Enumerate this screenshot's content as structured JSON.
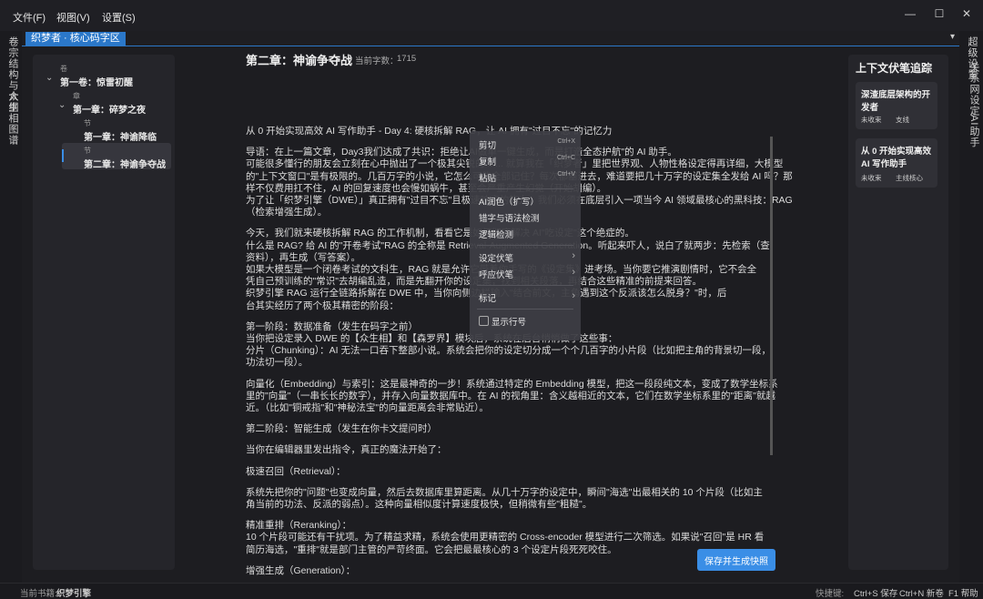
{
  "menubar": {
    "items": [
      "文件(F)",
      "视图(V)",
      "设置(S)"
    ],
    "window_controls": [
      "—",
      "☐",
      "✕"
    ]
  },
  "left_rail": {
    "tabs": [
      "卷宗结构与大纲",
      "众生相图谱"
    ]
  },
  "right_rail": {
    "tabs": [
      "超级设置",
      "关系网设定",
      "AI助手"
    ]
  },
  "tab": {
    "label": "织梦者 · 核心码字区"
  },
  "tree": {
    "volume_tag": "卷",
    "volume": "第一卷：惊雷初醒",
    "chapter_tag": "章",
    "chapter": "第一章：碎梦之夜",
    "sections": [
      {
        "tag": "节",
        "title": "第一章：神谕降临"
      },
      {
        "tag": "节",
        "title": "第二章：神谕争夺战"
      }
    ]
  },
  "editor": {
    "title": "第二章：神谕争夺战",
    "word_count_label": "当前字数：",
    "word_count": "1715",
    "lines": [
      "从 0 开始实现高效 AI 写作助手 - Day 4: 硬核拆解 RAG，让 AI 拥有\"过目不忘\"的记忆力",
      "",
      "      导语：在上一篇文章，Day3我们达成了共识：拒绝让AI做单一键生成，而是打造全态护航\"的 AI 助手。",
      "可能很多懂行的朋友会立刻在心中抛出了一个极其尖锐的 ...... 就算我在「织梦者」里把世界观、人物性格设定得再详细，大模型",
      "的\"上下文窗口\"是有极限的。几百万字的小说，它怎么可能全部记住？每次都塞进去，难道要把几十万字的设定集全发给 AI 吗？那",
      "样不仅费用扛不住，AI 的回复速度也会慢如蜗牛，甚至会严重产生幻觉（开始胡编）。",
      "为了让「织梦引擎（DWE）」真正拥有\"过目不忘\"且极速响应的能力，我们必须在底层引入一项当今 AI 领域最核心的黑科技：RAG",
      "（检索增强生成）。",
      "",
      "      今天，我们就来硬核拆解 RAG 的工作机制，看看它是如何彻底解决 AI\"吃设定\"这个绝症的。",
      "什么是 RAG? 给 AI 的\"开卷考试\"RAG 的全称是 Retrieval-Augmented Generation。听起来吓人，说白了就两步：先检索（查",
      "资料），再生成（写答案）。",
      "      如果大模型是一个闭卷考试的文科生，RAG 就是允许它带着你手写的《设定集》进考场。当你要它推演剧情时，它不会全",
      "凭自己预训练的\"常识\"去胡编乱造，而是先翻开你的设定集，找到相关段落，再结合这些精准的前提来回答。",
      "织梦引擎 RAG 运行全链路拆解在 DWE 中，当你向侧边栏输入\"结合前文，主角遇到这个反派该怎么脱身？\"时，后",
      "台其实经历了两个极其精密的阶段：",
      "",
      "第一阶段：数据准备（发生在码字之前）",
      "      当你把设定录入 DWE 的【众生相】和【森罗界】模块后，系统在后台悄悄做了这些事：",
      "分片（Chunking）：AI 无法一口吞下整部小说。系统会把你的设定切分成一个个几百字的小片段（比如把主角的背景切一段，",
      "功法切一段）。",
      "",
      "      向量化（Embedding）与索引：这是最神奇的一步！系统通过特定的 Embedding 模型，把这一段段纯文本，变成了数学坐标系",
      "里的\"向量\"（一串长长的数字），并存入向量数据库中。在 AI 的视角里：含义越相近的文本，它们在数学坐标系里的\"距离\"就越",
      "近。（比如\"铜戒指\"和\"神秘法宝\"的向量距离会非常贴近）。",
      "",
      "第二阶段：智能生成（发生在你卡文提问时）",
      "",
      "当你在编辑器里发出指令，真正的魔法开始了：",
      "",
      "极速召回（Retrieval）：",
      "",
      "      系统先把你的\"问题\"也变成向量，然后去数据库里算距离。从几十万字的设定中，瞬间\"海选\"出最相关的 10 个片段（比如主",
      "角当前的功法、反派的弱点）。这种向量相似度计算速度极快，但稍微有些\"粗糙\"。",
      "",
      "精准重排（Reranking）：",
      "      10 个片段可能还有干扰项。为了精益求精，系统会使用更精密的 Cross-encoder 模型进行二次筛选。如果说\"召回\"是 HR 看",
      "简历海选，\"重排\"就是部门主管的严苛终面。它会把最最核心的 3 个设定片段死死咬住。",
      "",
      "增强生成（Generation）："
    ],
    "save_button": "保存并生成快照"
  },
  "context_menu": {
    "items": [
      {
        "label": "剪切",
        "shortcut": "Ctrl+X"
      },
      {
        "label": "复制",
        "shortcut": "Ctrl+C"
      },
      {
        "label": "粘贴",
        "shortcut": "Ctrl+V"
      },
      {
        "label": "AI润色（扩写）",
        "shortcut": ""
      },
      {
        "label": "错字与语法检测",
        "shortcut": ""
      },
      {
        "label": "逻辑检测",
        "shortcut": ""
      },
      {
        "label": "设定伏笔",
        "shortcut": "›"
      },
      {
        "label": "呼应伏笔",
        "shortcut": "›"
      },
      {
        "label": "标记",
        "shortcut": "›"
      },
      {
        "label": "显示行号",
        "shortcut": ""
      }
    ]
  },
  "right_panel": {
    "title": "上下文伏笔追踪",
    "cards": [
      {
        "title": "深渣底层架构的开发者",
        "status": "未收束",
        "tag": "支线"
      },
      {
        "title": "从 0 开始实现高效 AI 写作助手",
        "status": "未收束",
        "tag": "主线核心"
      }
    ]
  },
  "statusbar": {
    "chapter_label": "当前书籍:",
    "chapter_value": "织梦引擎",
    "shortcut_label": "快捷键:",
    "shortcuts": [
      "Ctrl+S 保存",
      "Ctrl+N 新卷",
      "F1 帮助"
    ]
  },
  "colors": {
    "accent": "#2b78c9",
    "button": "#3a8ee6",
    "highlight": "#2b5f9e"
  }
}
